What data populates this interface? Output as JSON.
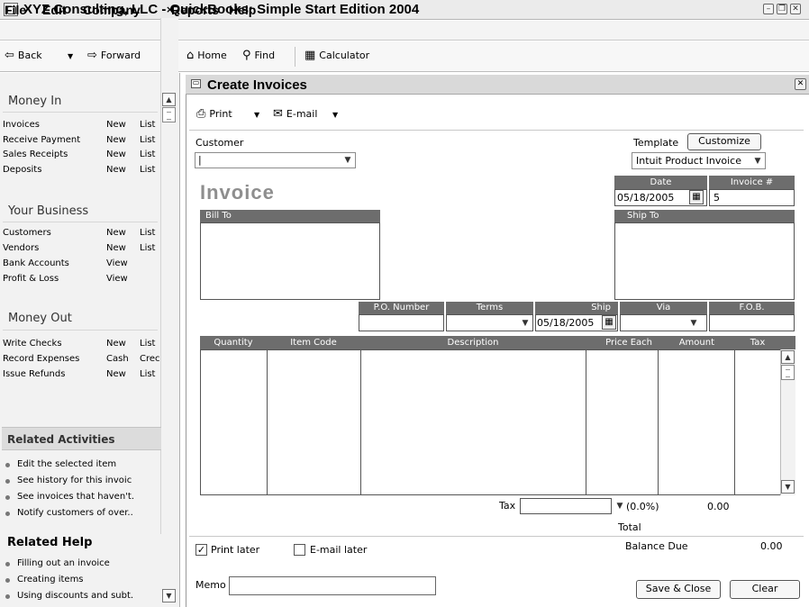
{
  "app": {
    "title": "XYZ Consulting, LLC - QuickBooks: Simple Start Edition 2004"
  },
  "menu": [
    "File",
    "Edit",
    "Company",
    "Reports",
    "Help"
  ],
  "toolbar": {
    "back": "Back",
    "forward": "Forward",
    "home": "Home",
    "find": "Find",
    "calculator": "Calculator"
  },
  "navigator": {
    "money_in": {
      "title": "Money In",
      "rows": [
        {
          "name": "Invoices",
          "a1": "New",
          "a2": "List"
        },
        {
          "name": "Receive Payment",
          "a1": "New",
          "a2": "List"
        },
        {
          "name": "Sales Receipts",
          "a1": "New",
          "a2": "List"
        },
        {
          "name": "Deposits",
          "a1": "New",
          "a2": "List"
        }
      ]
    },
    "your_business": {
      "title": "Your Business",
      "rows": [
        {
          "name": "Customers",
          "a1": "New",
          "a2": "List"
        },
        {
          "name": "Vendors",
          "a1": "New",
          "a2": "List"
        },
        {
          "name": "Bank Accounts",
          "a1": "View",
          "a2": ""
        },
        {
          "name": "Profit & Loss",
          "a1": "View",
          "a2": ""
        }
      ]
    },
    "money_out": {
      "title": "Money Out",
      "rows": [
        {
          "name": "Write Checks",
          "a1": "New",
          "a2": "List"
        },
        {
          "name": "Record Expenses",
          "a1": "Cash",
          "a2": "Crec"
        },
        {
          "name": "Issue Refunds",
          "a1": "New",
          "a2": "List"
        }
      ]
    },
    "related_activities": {
      "title": "Related Activities",
      "items": [
        "Edit the selected item",
        "See history for this invoic",
        "See invoices that haven't.",
        "Notify customers of over.."
      ]
    },
    "related_help": {
      "title": "Related Help",
      "items": [
        "Filling out an invoice",
        "Creating items",
        "Using discounts and subt."
      ]
    }
  },
  "invoice_window": {
    "title": "Create Invoices",
    "print": "Print",
    "email": "E-mail",
    "customer_label": "Customer",
    "customer_value": "|",
    "template_label": "Template",
    "customize": "Customize",
    "template_value": "Intuit Product Invoice",
    "heading": "Invoice",
    "date_label": "Date",
    "date_value": "05/18/2005",
    "invoice_no_label": "Invoice #",
    "invoice_no_value": "5",
    "bill_to": "Bill To",
    "ship_to": "Ship To",
    "po_number": "P.O. Number",
    "terms": "Terms",
    "ship": "Ship",
    "ship_value": "05/18/2005",
    "via": "Via",
    "fob": "F.O.B.",
    "columns": [
      "Quantity",
      "Item Code",
      "Description",
      "Price Each",
      "Amount",
      "Tax"
    ],
    "tax_label": "Tax",
    "tax_rate": "(0.0%)",
    "tax_amount": "0.00",
    "total_label": "Total",
    "print_later": "Print later",
    "email_later": "E-mail later",
    "balance_due_label": "Balance Due",
    "balance_due_value": "0.00",
    "memo_label": "Memo",
    "save_close": "Save & Close",
    "clear": "Clear"
  }
}
